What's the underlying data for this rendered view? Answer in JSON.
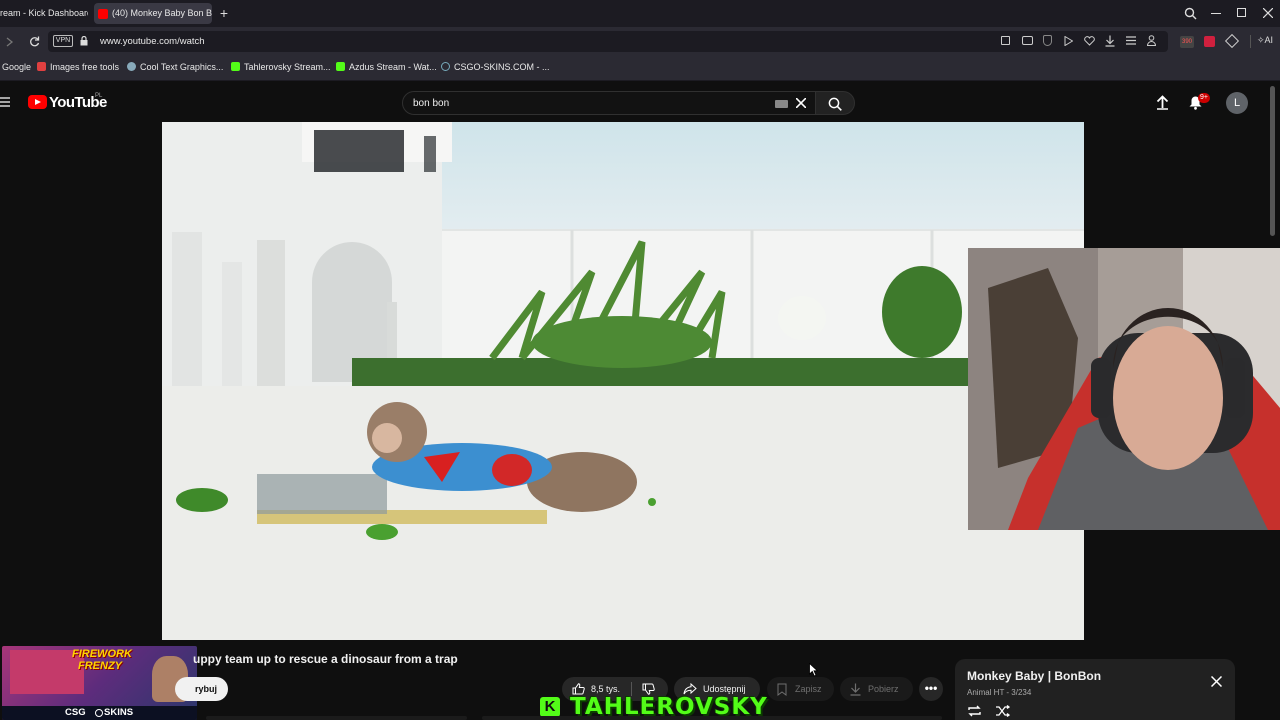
{
  "browser": {
    "tabs": [
      {
        "label": "ream - Kick Dashboard",
        "active": false
      },
      {
        "label": "(40) Monkey Baby Bon Bo",
        "active": true
      }
    ],
    "url": "www.youtube.com/watch",
    "vpn_label": "VPN",
    "ext_badge": "390",
    "ai_label": "AI",
    "bookmarks": [
      {
        "label": "Google",
        "icon": "google-icon"
      },
      {
        "label": "Images free tools",
        "icon": "bookmark-red-icon"
      },
      {
        "label": "Cool Text Graphics...",
        "icon": "bookmark-star-icon"
      },
      {
        "label": "Tahlerovsky Stream...",
        "icon": "kick-icon"
      },
      {
        "label": "Azdus Stream - Wat...",
        "icon": "kick-icon"
      },
      {
        "label": "CSGO-SKINS.COM - ...",
        "icon": "globe-icon"
      }
    ]
  },
  "youtube": {
    "logo_text": "YouTube",
    "region": "PL",
    "search_value": "bon bon",
    "notif_badge": "9+",
    "avatar_letter": "L"
  },
  "video": {
    "title": "uppy team up to rescue a dinosaur from a trap",
    "subscribe_label": "rybuj",
    "like_count": "8,5 tys.",
    "share_label": "Udostępnij",
    "save_label": "Zapisz",
    "download_label": "Pobierz"
  },
  "playlist": {
    "title": "Monkey Baby | BonBon",
    "meta": "Animal HT - 3/234"
  },
  "overlay": {
    "streamer_name": "TAHLEROVSKY",
    "ad_title_1": "FIREWORK",
    "ad_title_2": "FRENZY",
    "ad_brand_left": "CSG",
    "ad_brand_right": "SKINS"
  },
  "colors": {
    "yt_red": "#ff0000",
    "kick_green": "#53fc18",
    "notif_red": "#cc0000"
  }
}
